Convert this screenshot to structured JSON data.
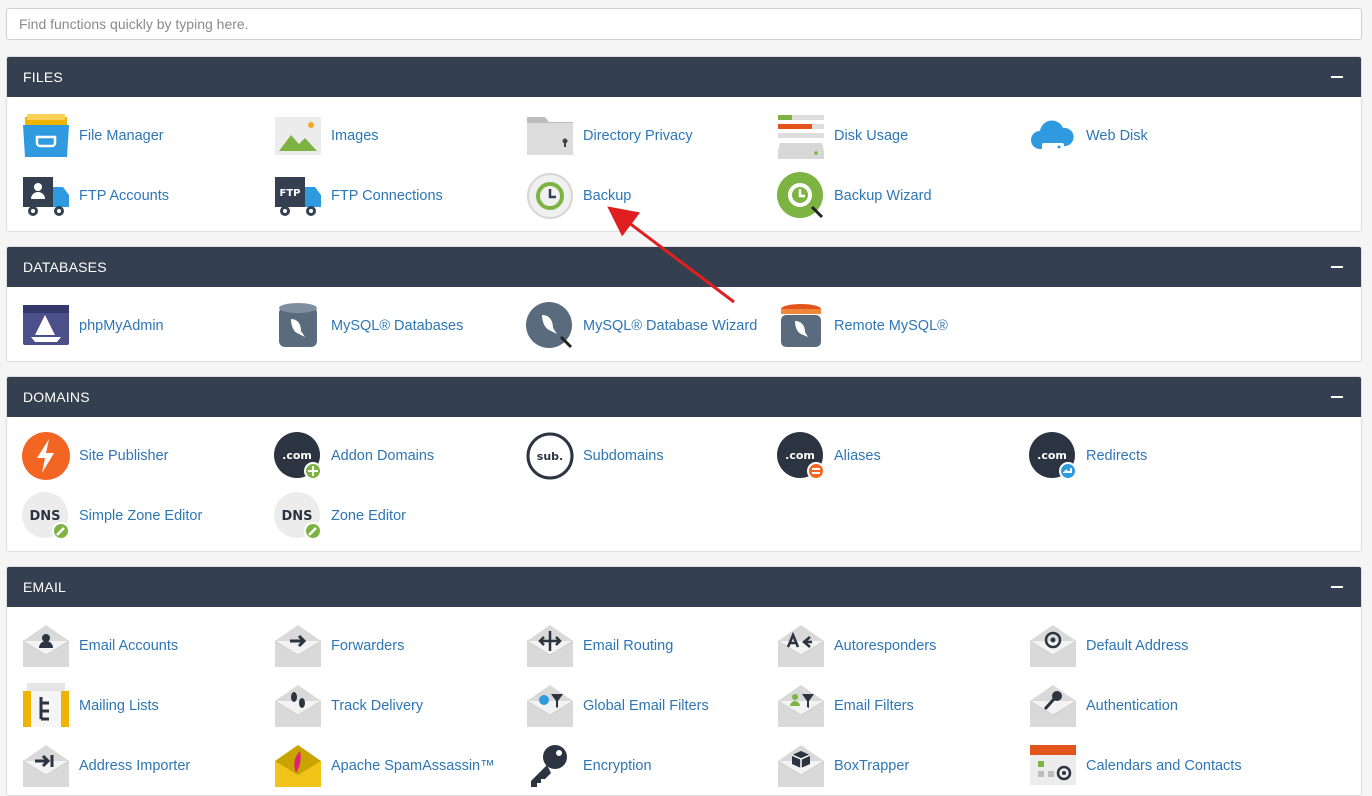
{
  "search": {
    "placeholder": "Find functions quickly by typing here."
  },
  "sections": [
    {
      "title": "FILES",
      "items": [
        {
          "label": "File Manager",
          "icon": "file-manager-icon"
        },
        {
          "label": "Images",
          "icon": "images-icon"
        },
        {
          "label": "Directory Privacy",
          "icon": "directory-privacy-icon"
        },
        {
          "label": "Disk Usage",
          "icon": "disk-usage-icon"
        },
        {
          "label": "Web Disk",
          "icon": "web-disk-icon"
        },
        {
          "label": "FTP Accounts",
          "icon": "ftp-accounts-icon"
        },
        {
          "label": "FTP Connections",
          "icon": "ftp-connections-icon"
        },
        {
          "label": "Backup",
          "icon": "backup-icon"
        },
        {
          "label": "Backup Wizard",
          "icon": "backup-wizard-icon"
        }
      ]
    },
    {
      "title": "DATABASES",
      "items": [
        {
          "label": "phpMyAdmin",
          "icon": "phpmyadmin-icon"
        },
        {
          "label": "MySQL® Databases",
          "icon": "mysql-databases-icon"
        },
        {
          "label": "MySQL® Database Wizard",
          "icon": "mysql-wizard-icon"
        },
        {
          "label": "Remote MySQL®",
          "icon": "remote-mysql-icon"
        }
      ]
    },
    {
      "title": "DOMAINS",
      "items": [
        {
          "label": "Site Publisher",
          "icon": "site-publisher-icon"
        },
        {
          "label": "Addon Domains",
          "icon": "addon-domains-icon"
        },
        {
          "label": "Subdomains",
          "icon": "subdomains-icon"
        },
        {
          "label": "Aliases",
          "icon": "aliases-icon"
        },
        {
          "label": "Redirects",
          "icon": "redirects-icon"
        },
        {
          "label": "Simple Zone Editor",
          "icon": "simple-zone-editor-icon"
        },
        {
          "label": "Zone Editor",
          "icon": "zone-editor-icon"
        }
      ]
    },
    {
      "title": "EMAIL",
      "items": [
        {
          "label": "Email Accounts",
          "icon": "email-accounts-icon"
        },
        {
          "label": "Forwarders",
          "icon": "forwarders-icon"
        },
        {
          "label": "Email Routing",
          "icon": "email-routing-icon"
        },
        {
          "label": "Autoresponders",
          "icon": "autoresponders-icon"
        },
        {
          "label": "Default Address",
          "icon": "default-address-icon"
        },
        {
          "label": "Mailing Lists",
          "icon": "mailing-lists-icon"
        },
        {
          "label": "Track Delivery",
          "icon": "track-delivery-icon"
        },
        {
          "label": "Global Email Filters",
          "icon": "global-email-filters-icon"
        },
        {
          "label": "Email Filters",
          "icon": "email-filters-icon"
        },
        {
          "label": "Authentication",
          "icon": "authentication-icon"
        },
        {
          "label": "Address Importer",
          "icon": "address-importer-icon"
        },
        {
          "label": "Apache SpamAssassin™",
          "icon": "apache-spamassassin-icon"
        },
        {
          "label": "Encryption",
          "icon": "encryption-icon"
        },
        {
          "label": "BoxTrapper",
          "icon": "boxtrapper-icon"
        },
        {
          "label": "Calendars and Contacts",
          "icon": "calendars-contacts-icon"
        }
      ]
    }
  ],
  "badges": {
    "dot_com": ".com",
    "sub": "sub.",
    "dns": "DNS",
    "ftp": "FTP"
  },
  "colors": {
    "header_bg": "#34404f",
    "link": "#2e76b5",
    "annotation_arrow": "#e02020"
  }
}
